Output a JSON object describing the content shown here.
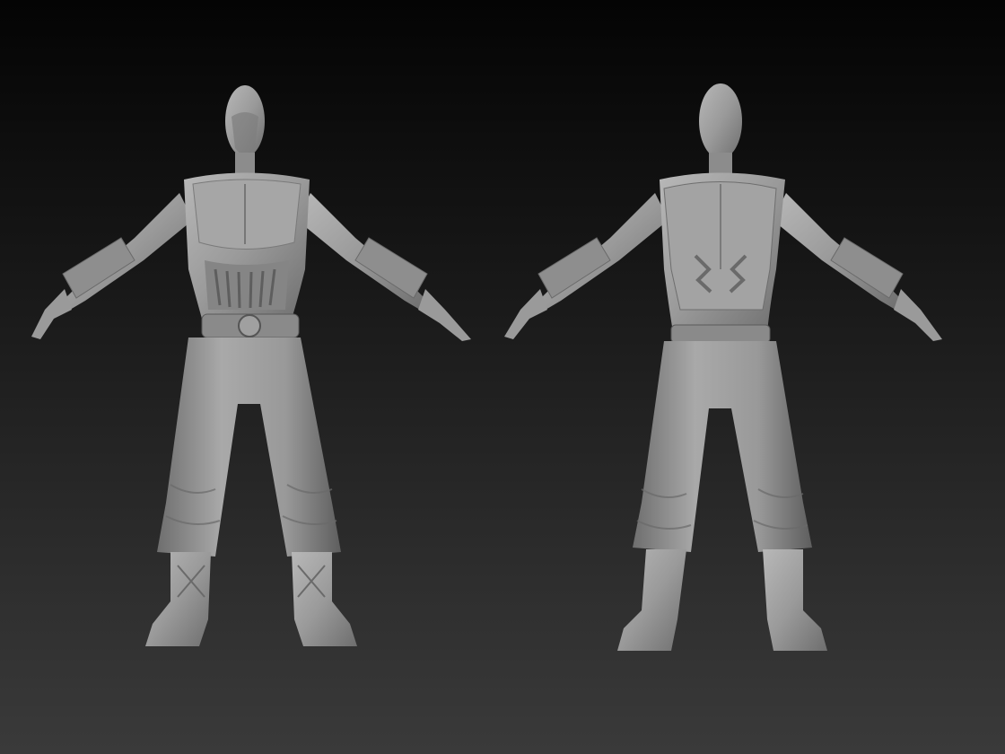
{
  "scene": {
    "subject": "character-sculpt-turnaround",
    "views": [
      {
        "id": "front",
        "orientation": "front-view"
      },
      {
        "id": "back",
        "orientation": "back-view"
      }
    ],
    "material_color": "#9a9a9a",
    "background_top": "#040404",
    "background_bottom": "#3a3a3a"
  }
}
